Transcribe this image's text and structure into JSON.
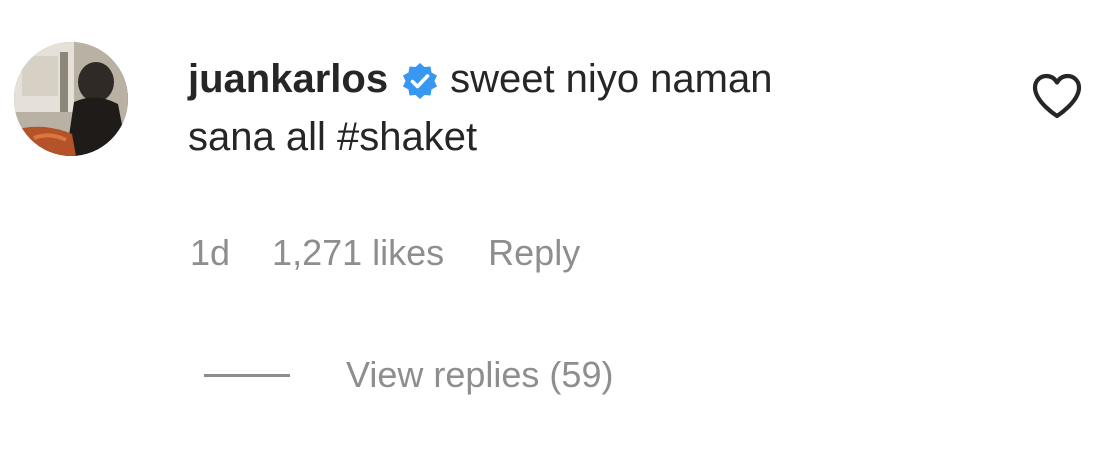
{
  "comment": {
    "username": "juankarlos",
    "verified_icon": "verified-badge-icon",
    "text_line1": "sweet niyo naman",
    "text_line2_prefix": "sana all ",
    "hashtag": "#shaket",
    "time": "1d",
    "likes": "1,271 likes",
    "reply_label": "Reply",
    "view_replies_label": "View replies (59)",
    "like_icon": "heart-outline-icon"
  },
  "colors": {
    "text_primary": "#262626",
    "text_secondary": "#8e8e8e",
    "verified_blue": "#3897f0"
  }
}
